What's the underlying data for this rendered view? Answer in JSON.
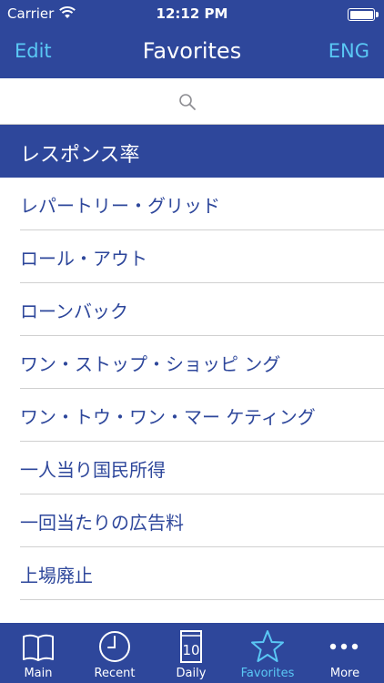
{
  "status_bar": {
    "carrier": "Carrier",
    "time": "12:12 PM"
  },
  "nav": {
    "left_button": "Edit",
    "title": "Favorites",
    "right_button": "ENG"
  },
  "search": {
    "placeholder": ""
  },
  "section": {
    "header": "レスポンス率"
  },
  "list": {
    "items": [
      "レパートリー・グリッド",
      "ロール・アウト",
      "ローンバック",
      "ワン・ストップ・ショッピ ング",
      "ワン・トウ・ワン・マー ケティング",
      "一人当り国民所得",
      "一回当たりの広告料",
      "上場廃止"
    ]
  },
  "tabs": {
    "main": "Main",
    "recent": "Recent",
    "daily": "Daily",
    "daily_icon_number": "10",
    "favorites": "Favorites",
    "more": "More"
  },
  "colors": {
    "brand_blue": "#2e479b",
    "accent_cyan": "#5ac8f5"
  },
  "icons": {
    "wifi": "wifi-icon",
    "battery": "battery-icon",
    "search": "search-icon",
    "main": "book-icon",
    "recent": "clock-icon",
    "daily": "calendar-icon",
    "favorites": "star-icon",
    "more": "ellipsis-icon"
  }
}
